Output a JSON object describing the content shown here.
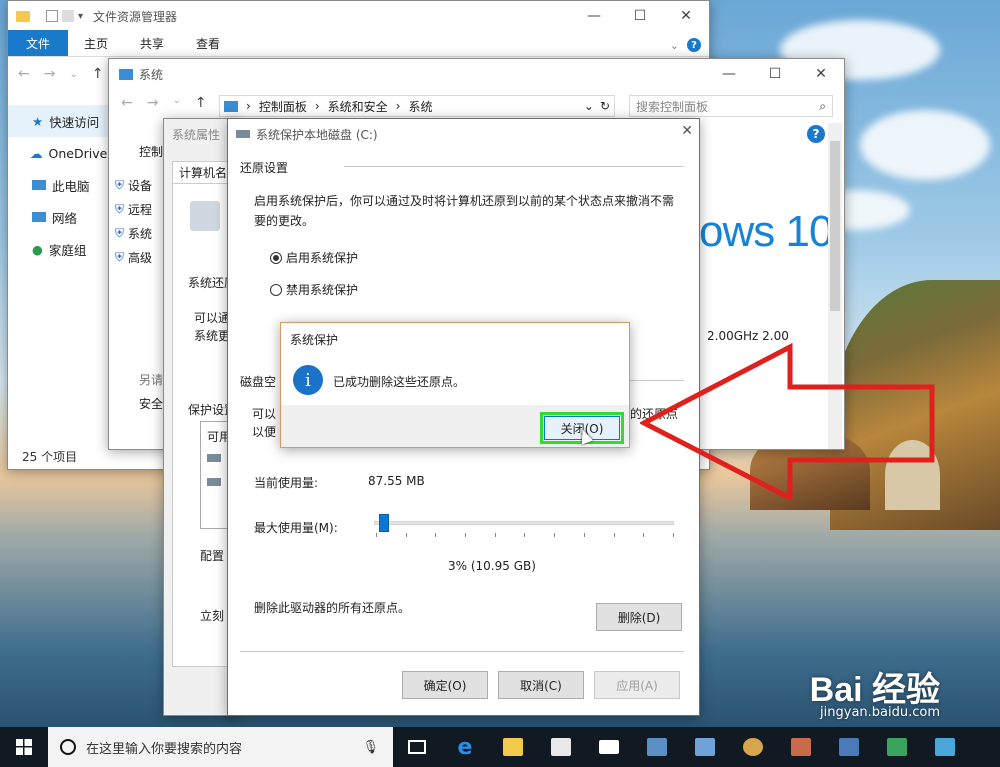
{
  "explorer": {
    "title": "文件资源管理器",
    "tabs": [
      "文件",
      "主页",
      "共享",
      "查看"
    ],
    "nav_items": [
      "快速访问",
      "OneDrive",
      "此电脑",
      "网络",
      "家庭组"
    ],
    "status": "25 个项目"
  },
  "system_window": {
    "title": "系统",
    "breadcrumb": [
      "控制面板",
      "系统和安全",
      "系统"
    ],
    "search_placeholder": "搜索控制面板",
    "left_header": "控制",
    "left_links": [
      "设备",
      "远程",
      "系统",
      "高级"
    ],
    "see_also_label": "另请",
    "security_label": "安全",
    "windows_logo_text": "ows 10",
    "cpu_text": "2.00GHz   2.00"
  },
  "system_properties": {
    "title": "系统属性",
    "tab_label": "计算机名",
    "restore_label": "系统还原",
    "restore_text_1": "可以通",
    "restore_text_2": "系统更",
    "protection_label": "保护设置",
    "list_header": "可用",
    "configure_label": "配置",
    "create_label": "立刻"
  },
  "protection_dialog": {
    "title": "系统保护本地磁盘 (C:)",
    "restore_group_title": "还原设置",
    "description": "启用系统保护后，你可以通过及时将计算机还原到以前的某个状态点来撤消不需要的更改。",
    "radio_enable": "启用系统保护",
    "radio_disable": "禁用系统保护",
    "enable_selected": true,
    "disk_group_title": "磁盘空",
    "disk_text_1": "可以",
    "disk_text_2": "以便",
    "disk_text_right": "的还原点",
    "current_usage_label": "当前使用量:",
    "current_usage_value": "87.55 MB",
    "max_usage_label": "最大使用量(M):",
    "max_usage_percent": 3,
    "max_usage_text": "3% (10.95 GB)",
    "delete_text": "删除此驱动器的所有还原点。",
    "delete_button": "删除(D)",
    "ok_button": "确定(O)",
    "cancel_button": "取消(C)",
    "apply_button": "应用(A)"
  },
  "message_box": {
    "title": "系统保护",
    "icon_glyph": "i",
    "message": "已成功删除这些还原点。",
    "close_button": "关闭(O)"
  },
  "taskbar": {
    "search_placeholder": "在这里输入你要搜索的内容"
  },
  "watermark": {
    "brand": "Bai 经验",
    "url": "jingyan.baidu.com"
  },
  "colors": {
    "accent": "#1979ca",
    "highlight": "#2dde2d",
    "arrow": "#e0201c"
  }
}
